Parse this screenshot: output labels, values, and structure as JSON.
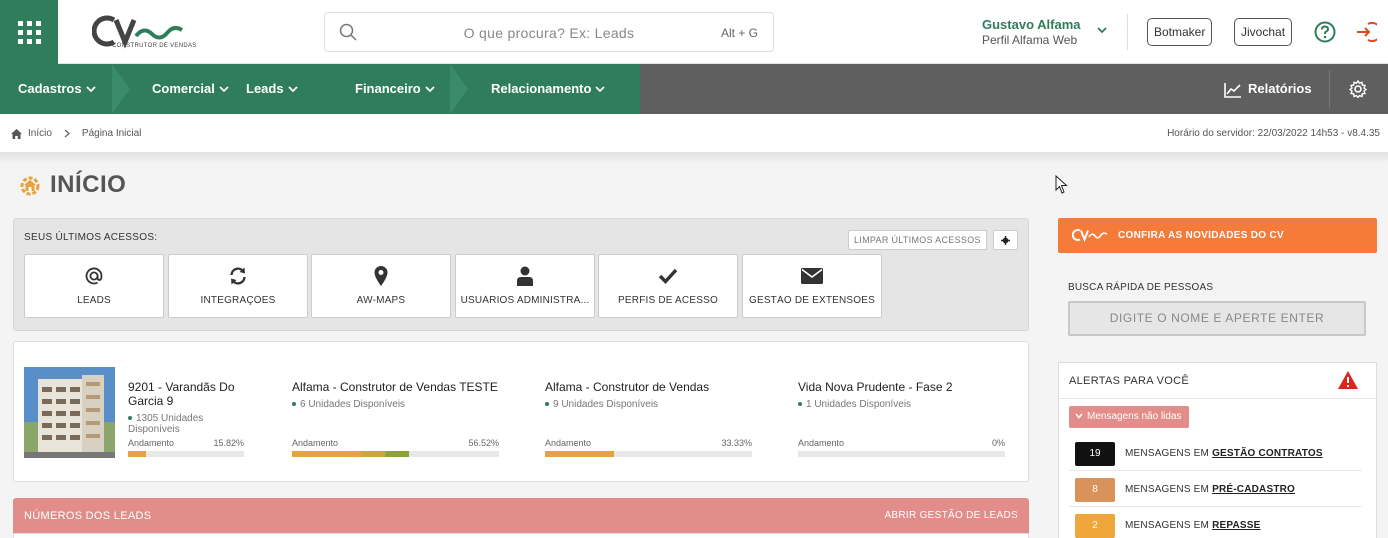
{
  "header": {
    "search_placeholder": "O que procura? Ex: Leads",
    "search_shortcut": "Alt + G",
    "user_name": "Gustavo Alfama",
    "user_profile": "Perfil Alfama Web",
    "ext_buttons": [
      "Botmaker",
      "Jivochat"
    ],
    "logo_subtitle": "CONSTRUTOR DE VENDAS"
  },
  "nav": {
    "items": [
      "Cadastros",
      "Comercial",
      "Leads",
      "Financeiro",
      "Relacionamento"
    ],
    "reports": "Relatórios"
  },
  "breadcrumb": {
    "home": "Início",
    "current": "Página Inicial",
    "server_time": "Horário do servidor: 22/03/2022 14h53 - v8.4.35"
  },
  "page": {
    "title": "INÍCIO"
  },
  "recent": {
    "title": "SEUS ÚLTIMOS ACESSOS:",
    "clear": "LIMPAR ÚLTIMOS ACESSOS",
    "tiles": [
      {
        "label": "LEADS",
        "icon": "at-icon"
      },
      {
        "label": "INTEGRAÇÕES",
        "icon": "sync-icon"
      },
      {
        "label": "AW-MAPS",
        "icon": "map-pin-icon"
      },
      {
        "label": "USUÁRIOS ADMINISTRA...",
        "icon": "user-icon"
      },
      {
        "label": "PERFIS DE ACESSO",
        "icon": "check-icon"
      },
      {
        "label": "GESTÃO DE EXTENSÕES",
        "icon": "envelope-icon"
      }
    ]
  },
  "projects": {
    "progress_label": "Andamento",
    "items": [
      {
        "name": "9201 - Varandãs Do Garcia 9",
        "units": "1305 Unidades Disponíveis",
        "progress": "15.82%",
        "progress_value": 15.82
      },
      {
        "name": "Alfama - Construtor de Vendas TESTE",
        "units": "6 Unidades Disponíveis",
        "progress": "56.52%",
        "progress_value": 56.52
      },
      {
        "name": "Alfama - Construtor de Vendas",
        "units": "9 Unidades Disponíveis",
        "progress": "33.33%",
        "progress_value": 33.33
      },
      {
        "name": "Vida Nova Prudente - Fase 2",
        "units": "1 Unidades Disponíveis",
        "progress": "0%",
        "progress_value": 0
      }
    ]
  },
  "leads": {
    "title": "NÚMEROS DOS LEADS",
    "link": "ABRIR GESTÃO DE LEADS"
  },
  "right": {
    "news": "CONFIRA AS NOVIDADES DO CV",
    "quick_label": "BUSCA RÁPIDA DE PESSOAS",
    "quick_placeholder": "DIGITE O NOME E APERTE ENTER",
    "alerts_title": "ALERTAS PARA VOCÊ",
    "unread": "Mensagens não lidas",
    "messages": [
      {
        "count": "19",
        "prefix": "MENSAGENS EM",
        "target": "GESTÃO CONTRATOS",
        "color": "#111111"
      },
      {
        "count": "8",
        "prefix": "MENSAGENS EM",
        "target": "PRÉ-CADASTRO",
        "color": "#d9925a"
      },
      {
        "count": "2",
        "prefix": "MENSAGENS EM",
        "target": "REPASSE",
        "color": "#f0a63a"
      }
    ]
  },
  "colors": {
    "brand_green": "#2f7d5b",
    "nav_gray": "#5f5f5f",
    "orange": "#f57b3a",
    "salmon": "#e38d8a",
    "progress": "#e6a23c"
  }
}
